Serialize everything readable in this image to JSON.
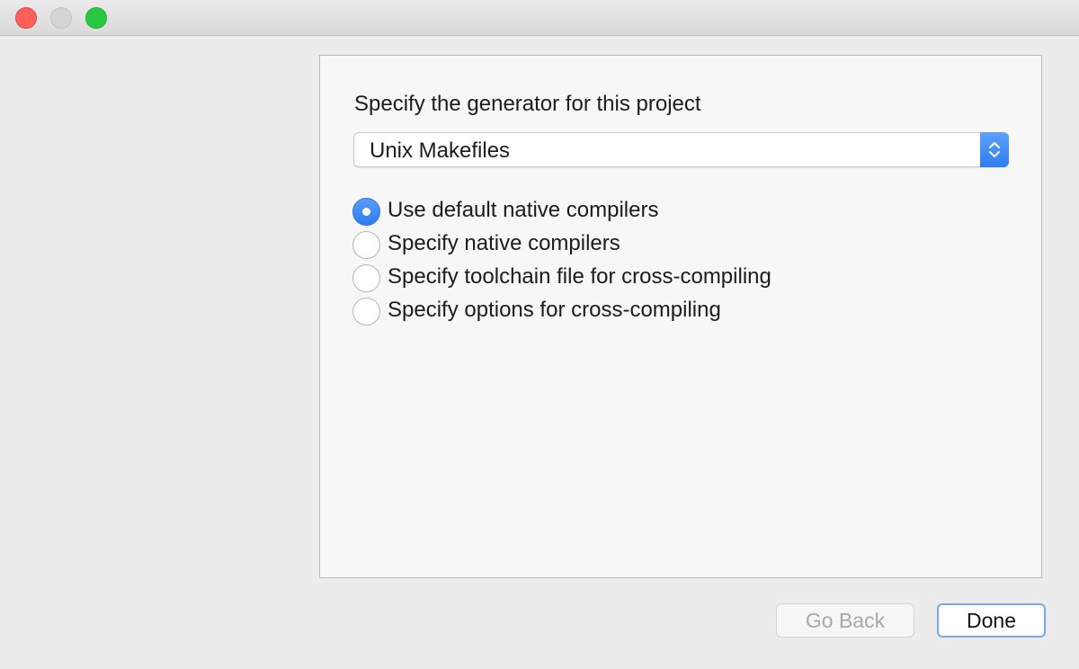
{
  "window": {
    "controls": {
      "close_icon": "close-icon",
      "minimize_icon": "minimize-icon",
      "maximize_icon": "maximize-icon"
    }
  },
  "wizard": {
    "prompt": "Specify the generator for this project",
    "generator": {
      "selected": "Unix Makefiles",
      "icon": "up-down-chevron-icon"
    },
    "options": [
      {
        "label": "Use default native compilers",
        "checked": true
      },
      {
        "label": "Specify native compilers",
        "checked": false
      },
      {
        "label": "Specify toolchain file for cross-compiling",
        "checked": false
      },
      {
        "label": "Specify options for cross-compiling",
        "checked": false
      }
    ]
  },
  "buttons": {
    "go_back": "Go Back",
    "done": "Done"
  },
  "colors": {
    "accent": "#2f7cf2",
    "close": "#fe5f57",
    "maximize": "#28c840"
  }
}
